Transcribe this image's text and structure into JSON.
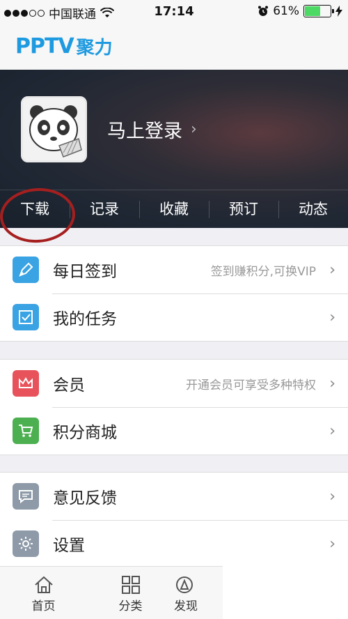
{
  "status_bar": {
    "carrier": "中国联通",
    "time": "17:14",
    "battery_text": "61%",
    "battery_level": 0.61,
    "signal_bars_filled": 3,
    "signal_bars_total": 5
  },
  "header": {
    "logo_main": "PPTV",
    "logo_suffix": "聚力",
    "logo_color": "#1e9ae0"
  },
  "profile": {
    "login_label": "马上登录",
    "chevron": "›"
  },
  "profile_tabs": [
    {
      "label": "下载"
    },
    {
      "label": "记录"
    },
    {
      "label": "收藏"
    },
    {
      "label": "预订"
    },
    {
      "label": "动态"
    }
  ],
  "menu_groups": [
    {
      "items": [
        {
          "label": "每日签到",
          "hint": "签到赚积分,可换VIP",
          "icon": "pen-icon",
          "icon_color": "#3aa3e3"
        },
        {
          "label": "我的任务",
          "hint": "",
          "icon": "checkbox-icon",
          "icon_color": "#3aa3e3"
        }
      ]
    },
    {
      "items": [
        {
          "label": "会员",
          "hint": "开通会员可享受多种特权",
          "icon": "crown-icon",
          "icon_color": "#e8525a"
        },
        {
          "label": "积分商城",
          "hint": "",
          "icon": "cart-icon",
          "icon_color": "#4caf50"
        }
      ]
    },
    {
      "items": [
        {
          "label": "意见反馈",
          "hint": "",
          "icon": "chat-icon",
          "icon_color": "#8e9aa8"
        },
        {
          "label": "设置",
          "hint": "",
          "icon": "gear-icon",
          "icon_color": "#8e9aa8"
        }
      ]
    }
  ],
  "chevron": "›",
  "tabbar": [
    {
      "label": "首页",
      "icon": "home-icon"
    },
    {
      "label": "分类",
      "icon": "grid-icon"
    },
    {
      "label": "发现",
      "icon": "discover-icon"
    }
  ]
}
